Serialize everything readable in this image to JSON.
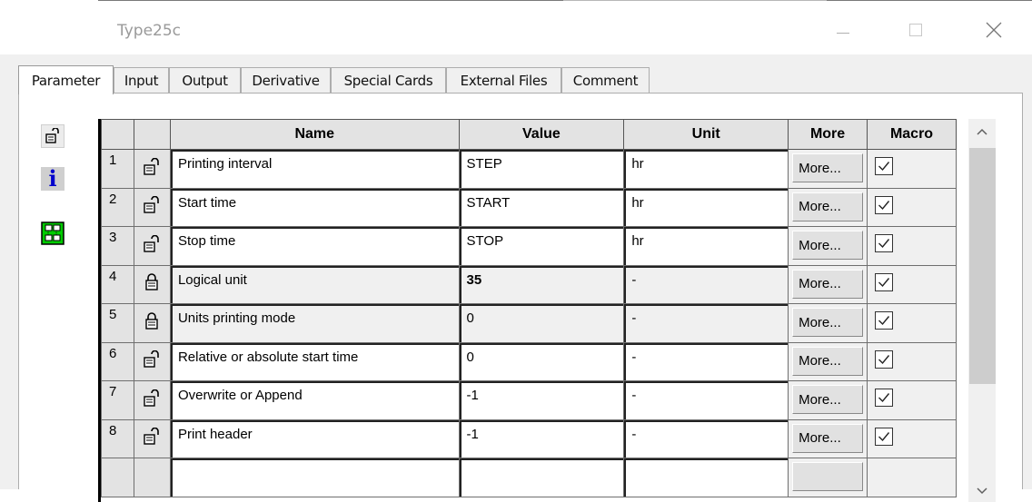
{
  "window": {
    "title": "Type25c"
  },
  "tabs": [
    {
      "label": "Parameter",
      "active": true
    },
    {
      "label": "Input"
    },
    {
      "label": "Output"
    },
    {
      "label": "Derivative"
    },
    {
      "label": "Special Cards"
    },
    {
      "label": "External Files"
    },
    {
      "label": "Comment"
    }
  ],
  "side_icons": [
    "lock-icon",
    "info-icon",
    "network-icon"
  ],
  "table": {
    "headers": {
      "name": "Name",
      "value": "Value",
      "unit": "Unit",
      "more": "More",
      "macro": "Macro"
    },
    "rows": [
      {
        "num": "1",
        "name": "Printing interval",
        "value": "STEP",
        "unit": "hr",
        "more": "More...",
        "macro": true
      },
      {
        "num": "2",
        "name": "Start time",
        "value": "START",
        "unit": "hr",
        "more": "More...",
        "macro": true
      },
      {
        "num": "3",
        "name": "Stop time",
        "value": "STOP",
        "unit": "hr",
        "more": "More...",
        "macro": true
      },
      {
        "num": "4",
        "name": "Logical unit",
        "value": "35",
        "unit": "-",
        "more": "More...",
        "macro": true
      },
      {
        "num": "5",
        "name": "Units printing mode",
        "value": "0",
        "unit": "-",
        "more": "More...",
        "macro": true
      },
      {
        "num": "6",
        "name": "Relative or absolute start time",
        "value": "0",
        "unit": "-",
        "more": "More...",
        "macro": true
      },
      {
        "num": "7",
        "name": "Overwrite or Append",
        "value": "-1",
        "unit": "-",
        "more": "More...",
        "macro": true
      },
      {
        "num": "8",
        "name": "Print header",
        "value": "-1",
        "unit": "-",
        "more": "More...",
        "macro": true
      }
    ]
  },
  "colors": {
    "dialog_bg": "#f0f0f0",
    "header_bg": "#e3e3e3",
    "info_icon": "#0000cc",
    "network_icon": "#00cc00"
  }
}
